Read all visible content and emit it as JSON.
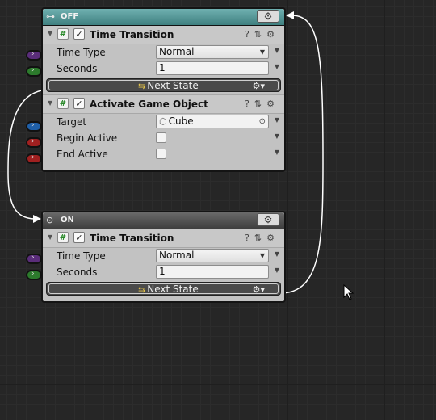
{
  "canvas": {
    "background": "#262626"
  },
  "colors": {
    "off_header": "#4f9a9a",
    "on_header": "#4a4a4a",
    "node_body": "#c2c2c2",
    "violet_port": "#5a2d7a",
    "green_port": "#2c7a2c",
    "blue_port": "#1f5fa8",
    "red_port": "#a02020",
    "wire": "#ffffff"
  },
  "off_node": {
    "title": "OFF",
    "header_icon": "key-icon",
    "gear": "⚙",
    "time_transition": {
      "title": "Time Transition",
      "time_type_label": "Time Type",
      "time_type_value": "Normal",
      "seconds_label": "Seconds",
      "seconds_value": "1",
      "event_label": "Next State"
    },
    "activate_game_object": {
      "title": "Activate Game Object",
      "target_label": "Target",
      "target_value": "Cube",
      "begin_active_label": "Begin Active",
      "end_active_label": "End Active"
    }
  },
  "on_node": {
    "title": "ON",
    "header_icon": "target-icon",
    "gear": "⚙",
    "time_transition": {
      "title": "Time Transition",
      "time_type_label": "Time Type",
      "time_type_value": "Normal",
      "seconds_label": "Seconds",
      "seconds_value": "1",
      "event_label": "Next State"
    }
  },
  "icons": {
    "fold": "▼",
    "script": "#",
    "check": "✓",
    "help": "?",
    "presets": "⇅",
    "settings": "⚙",
    "dropdown": "▼",
    "row_menu": "▼",
    "event": "⇆",
    "event_gear": "⚙▾",
    "port": "›",
    "object": "⬡",
    "picker": "⊙"
  }
}
